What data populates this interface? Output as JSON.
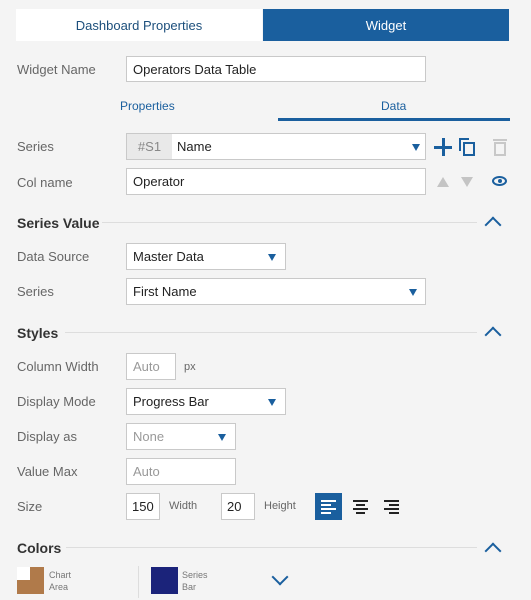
{
  "tabs": {
    "dashboard_properties": "Dashboard Properties",
    "widget": "Widget"
  },
  "widget_name": {
    "label": "Widget Name",
    "value": "Operators Data Table"
  },
  "subtabs": {
    "properties": "Properties",
    "data": "Data"
  },
  "series": {
    "label": "Series",
    "tag": "#S1",
    "value": "Name"
  },
  "col_name": {
    "label": "Col name",
    "value": "Operator"
  },
  "series_value": {
    "title": "Series Value",
    "data_source": {
      "label": "Data Source",
      "value": "Master Data"
    },
    "series": {
      "label": "Series",
      "value": "First Name"
    }
  },
  "styles": {
    "title": "Styles",
    "column_width": {
      "label": "Column Width",
      "placeholder": "Auto",
      "unit": "px"
    },
    "display_mode": {
      "label": "Display Mode",
      "value": "Progress Bar"
    },
    "display_as": {
      "label": "Display as",
      "value": "None"
    },
    "value_max": {
      "label": "Value Max",
      "placeholder": "Auto"
    },
    "size": {
      "label": "Size",
      "width": "150",
      "width_label": "Width",
      "height": "20",
      "height_label": "Height"
    }
  },
  "colors": {
    "title": "Colors",
    "chart_area": {
      "line1": "Chart",
      "line2": "Area",
      "color": "#b07a4a"
    },
    "series_bar": {
      "line1": "Series",
      "line2": "Bar",
      "color": "#1b237a"
    }
  }
}
